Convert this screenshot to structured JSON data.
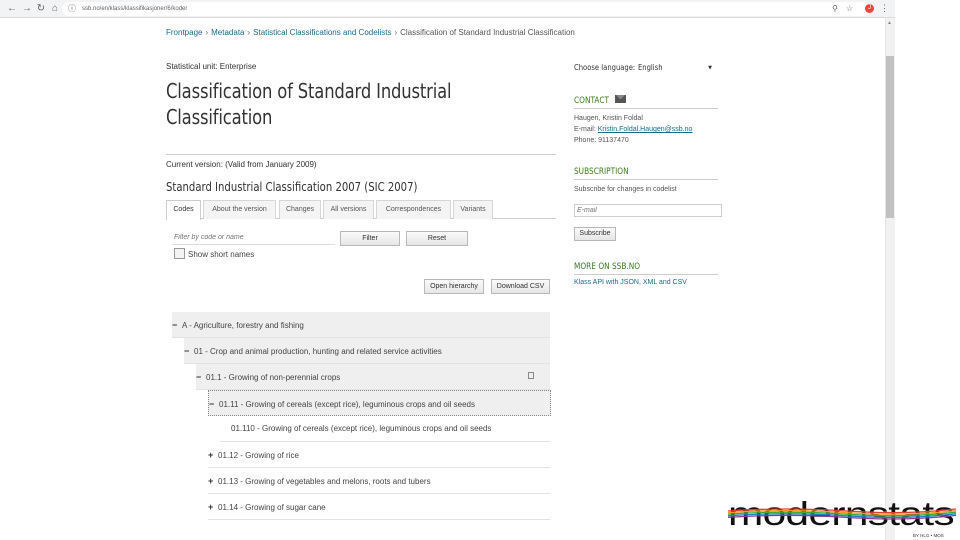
{
  "browser": {
    "url": "ssb.no/en/klass/klassifikasjoner/6/koder"
  },
  "breadcrumb": {
    "items": [
      "Frontpage",
      "Metadata",
      "Statistical Classifications and Codelists"
    ],
    "current": "Classification of Standard Industrial Classification",
    "separator": "›"
  },
  "main": {
    "statistical_unit": "Statistical unit: Enterprise",
    "title": "Classification of Standard Industrial Classification",
    "current_version": "Current version: (Valid from January 2009)",
    "version_title": "Standard Industrial Classification 2007 (SIC 2007)",
    "tabs": [
      "Codes",
      "About the version",
      "Changes",
      "All versions",
      "Correspondences",
      "Variants"
    ],
    "filter_placeholder": "Filter by code or name",
    "filter_button": "Filter",
    "reset_button": "Reset",
    "show_short_names": "Show short names",
    "open_hierarchy": "Open hierarchy",
    "download_csv": "Download CSV",
    "tree": [
      {
        "toggle": "−",
        "label": "A - Agriculture, forestry and fishing"
      },
      {
        "toggle": "−",
        "label": "01 - Crop and animal production, hunting and related service activities"
      },
      {
        "toggle": "−",
        "label": "01.1 - Growing of non-perennial crops"
      },
      {
        "toggle": "−",
        "label": "01.11 - Growing of cereals (except rice), leguminous crops and oil seeds"
      },
      {
        "toggle": "",
        "label": "01.110 - Growing of cereals (except rice), leguminous crops and oil seeds"
      },
      {
        "toggle": "+",
        "label": "01.12 - Growing of rice"
      },
      {
        "toggle": "+",
        "label": "01.13 - Growing of vegetables and melons, roots and tubers"
      },
      {
        "toggle": "+",
        "label": "01.14 - Growing of sugar cane"
      }
    ]
  },
  "sidebar": {
    "language_label": "Choose language:",
    "language_value": "English",
    "contact_heading": "Contact",
    "contact_name": "Haugen, Kristin Foldal",
    "contact_email_label": "E-mail:",
    "contact_email": "Kristin.Foldal.Haugen@ssb.no",
    "contact_phone": "Phone: 91137470",
    "subscription_heading": "Subscription",
    "subscription_text": "Subscribe for changes in codelist",
    "email_placeholder": "E-mail",
    "subscribe_button": "Subscribe",
    "more_heading": "More on SSB.no",
    "more_text": "Klass API with JSON, XML and CSV"
  },
  "logo": {
    "name": "modernstats",
    "tagline": "BY HLG • MOS"
  },
  "colors": {
    "accent_green": "#3c7a1a",
    "link_blue": "#1a6b91",
    "logo_stripe": [
      "#e23c2c",
      "#f29a1f",
      "#3aaa35",
      "#1f7fc3",
      "#8e3b96"
    ]
  }
}
